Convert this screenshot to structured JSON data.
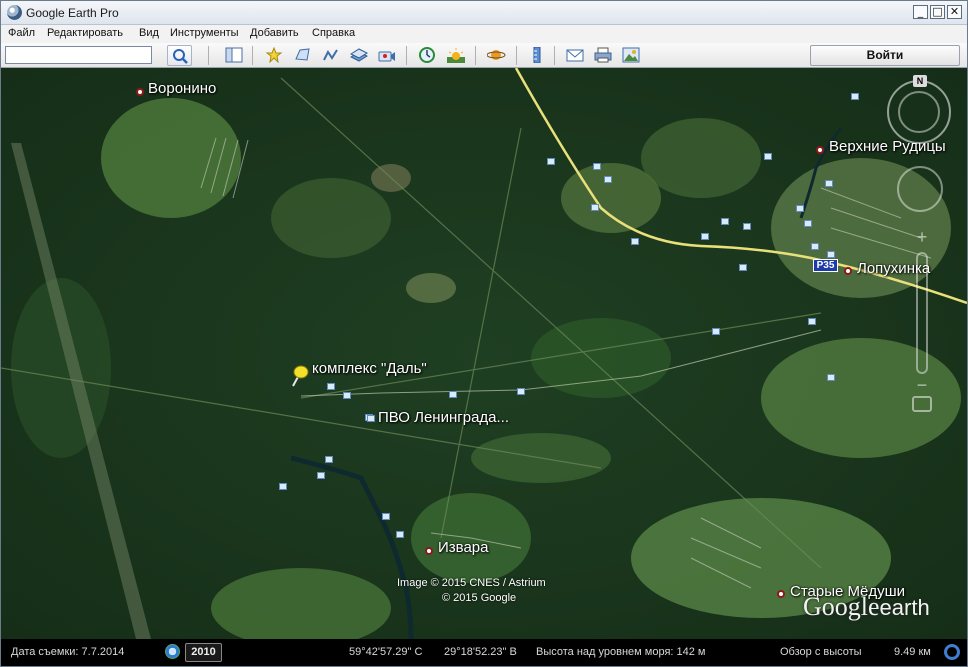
{
  "window": {
    "title": "Google Earth Pro",
    "min": "_",
    "max": "□",
    "close": "✕"
  },
  "menu": [
    "Файл",
    "Редактировать",
    "Вид",
    "Инструменты",
    "Добавить",
    "Справка"
  ],
  "toolbar": {
    "search_value": "",
    "signin_label": "Войти",
    "icons": [
      "search-icon",
      "sidebar-toggle-icon",
      "add-placemark-icon",
      "add-polygon-icon",
      "add-path-icon",
      "add-image-overlay-icon",
      "record-tour-icon",
      "historical-imagery-icon",
      "sunlight-icon",
      "planets-icon",
      "ruler-icon",
      "email-icon",
      "print-icon",
      "save-image-icon"
    ]
  },
  "map": {
    "places": [
      {
        "name": "Воронино"
      },
      {
        "name": "Верхние Рудицы"
      },
      {
        "name": "Лопухинка"
      },
      {
        "name": "Извара"
      },
      {
        "name": "Старые Мёдуши"
      }
    ],
    "placemark": {
      "label": "комплекс \"Даль\"",
      "icon": "yellow-pushpin-icon"
    },
    "photo_label": "ПВО Ленинграда...",
    "road_sign": "Р35",
    "copyright_lines": [
      "Image © 2015 CNES / Astrium",
      "© 2015 Google"
    ],
    "logo_text": {
      "google": "Google",
      "earth": "earth"
    },
    "compass_label": "N",
    "colors": {
      "place_pin": "#8b1a1a",
      "road": "#e8e07a",
      "road_sign": "#1e3aa8"
    }
  },
  "status": {
    "imagery_date": "Дата съемки: 7.7.2014",
    "historical_year": "2010",
    "latitude": "59°42'57.29\" С",
    "longitude": "29°18'52.23\" В",
    "elevation": "Высота над уровнем моря:   142 м",
    "eye_alt_label": "Обзор с высоты",
    "eye_alt_value": "9.49 км"
  }
}
